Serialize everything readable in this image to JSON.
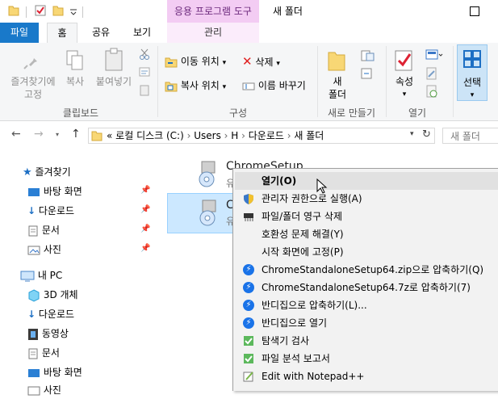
{
  "titlebar": {
    "tool_tab_label": "응용 프로그램 도구",
    "window_title": "새 폴더"
  },
  "tabs": {
    "file": "파일",
    "home": "홈",
    "share": "공유",
    "view": "보기",
    "manage": "관리"
  },
  "ribbon": {
    "clipboard": {
      "pin_label_1": "즐겨찾기에",
      "pin_label_2": "고정",
      "copy": "복사",
      "paste": "붙여넣기",
      "group": "클립보드"
    },
    "organize": {
      "move_to": "이동 위치",
      "copy_to": "복사 위치",
      "delete": "삭제",
      "rename": "이름 바꾸기",
      "group": "구성"
    },
    "new": {
      "new_folder_1": "새",
      "new_folder_2": "폴더",
      "group": "새로 만들기"
    },
    "open": {
      "properties": "속성",
      "group": "열기"
    },
    "select": {
      "label": "선택"
    }
  },
  "address": {
    "crumbs": [
      "«",
      "로컬 디스크 (C:)",
      "Users",
      "H",
      "다운로드",
      "새 폴더"
    ],
    "search_placeholder": "새 폴더"
  },
  "navpane": {
    "items": [
      {
        "label": "즐겨찾기"
      },
      {
        "label": "바탕 화면"
      },
      {
        "label": "다운로드"
      },
      {
        "label": "문서"
      },
      {
        "label": "사진"
      },
      {
        "label": "내 PC"
      },
      {
        "label": "3D 개체"
      },
      {
        "label": "다운로드"
      },
      {
        "label": "동영상"
      },
      {
        "label": "문서"
      },
      {
        "label": "바탕 화면"
      },
      {
        "label": "사진"
      }
    ]
  },
  "files": [
    {
      "name": "ChromeSetup",
      "sub": "유"
    },
    {
      "name": "C",
      "sub": "유"
    }
  ],
  "context_menu": [
    {
      "label": "열기(O)",
      "icon": "none"
    },
    {
      "label": "관리자 권한으로 실행(A)",
      "icon": "shield-icon"
    },
    {
      "label": "파일/폴더 영구 삭제",
      "icon": "shredder-icon"
    },
    {
      "label": "호환성 문제 해결(Y)",
      "icon": "none"
    },
    {
      "label": "시작 화면에 고정(P)",
      "icon": "none"
    },
    {
      "label": "ChromeStandaloneSetup64.zip으로 압축하기(Q)",
      "icon": "bandizip-icon"
    },
    {
      "label": "ChromeStandaloneSetup64.7z로 압축하기(7)",
      "icon": "bandizip-icon"
    },
    {
      "label": "반디집으로 압축하기(L)...",
      "icon": "bandizip-icon"
    },
    {
      "label": "반디집으로 열기",
      "icon": "bandizip-icon"
    },
    {
      "label": "탐색기 검사",
      "icon": "scan-icon"
    },
    {
      "label": "파일 분석 보고서",
      "icon": "scan-icon"
    },
    {
      "label": "Edit with Notepad++",
      "icon": "notepadpp-icon"
    }
  ],
  "colors": {
    "file_tab": "#1979ca",
    "tool_tab": "#f3ccf3",
    "selection": "#cce8ff",
    "menu_bg": "#f2f2f2"
  }
}
